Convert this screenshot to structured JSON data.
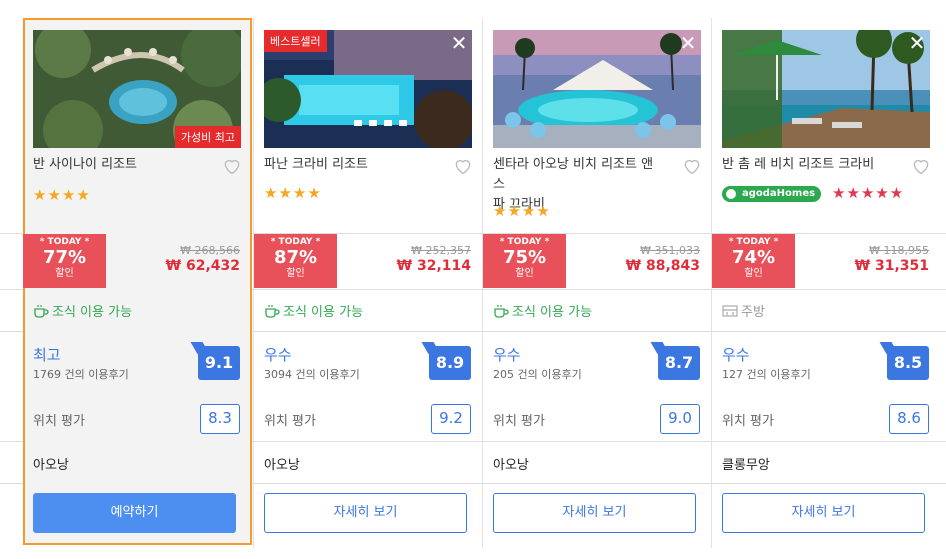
{
  "cards": [
    {
      "name": "반 사이나이 리조트",
      "photo_badge": "가성비 최고",
      "stars": "★★★★",
      "today_label": "* TODAY *",
      "discount": "77%",
      "discount_suffix": "할인",
      "original_price": "₩ 268,566",
      "price": "₩ 62,432",
      "amenity": "조식 이용 가능",
      "review_label": "최고",
      "review_count": "1769 건의 이용후기",
      "score": "9.1",
      "location_label": "위치 평가",
      "location_score": "8.3",
      "area": "아오낭",
      "button": "예약하기"
    },
    {
      "name": "파난 크라비 리조트",
      "photo_badge": "베스트셀러",
      "stars": "★★★★",
      "today_label": "* TODAY *",
      "discount": "87%",
      "discount_suffix": "할인",
      "original_price": "₩ 252,357",
      "price": "₩ 32,114",
      "amenity": "조식 이용 가능",
      "review_label": "우수",
      "review_count": "3094 건의 이용후기",
      "score": "8.9",
      "location_label": "위치 평가",
      "location_score": "9.2",
      "area": "아오낭",
      "button": "자세히 보기"
    },
    {
      "name_line1": "센타라 아오낭 비치 리조트 앤 스",
      "name_line2": "파 끄라비",
      "stars": "★★★★",
      "today_label": "* TODAY *",
      "discount": "75%",
      "discount_suffix": "할인",
      "original_price": "₩ 351,033",
      "price": "₩ 88,843",
      "amenity": "조식 이용 가능",
      "review_label": "우수",
      "review_count": "205 건의 이용후기",
      "score": "8.7",
      "location_label": "위치 평가",
      "location_score": "9.0",
      "area": "아오낭",
      "button": "자세히 보기"
    },
    {
      "name": "반 촘 레 비치 리조트 크라비",
      "agoda": "agodaHomes",
      "pink_stars": "★★★★★",
      "today_label": "* TODAY *",
      "discount": "74%",
      "discount_suffix": "할인",
      "original_price": "₩ 118,955",
      "price": "₩ 31,351",
      "amenity": "주방",
      "review_label": "우수",
      "review_count": "127 건의 이용후기",
      "score": "8.5",
      "location_label": "위치 평가",
      "location_score": "8.6",
      "area": "클롱무앙",
      "button": "자세히 보기"
    }
  ],
  "colors": {
    "accent": "#3b76e1",
    "deal": "#e8515a",
    "selected_border": "#f59b2b",
    "amenity": "#34a853",
    "price": "#e12d39"
  }
}
